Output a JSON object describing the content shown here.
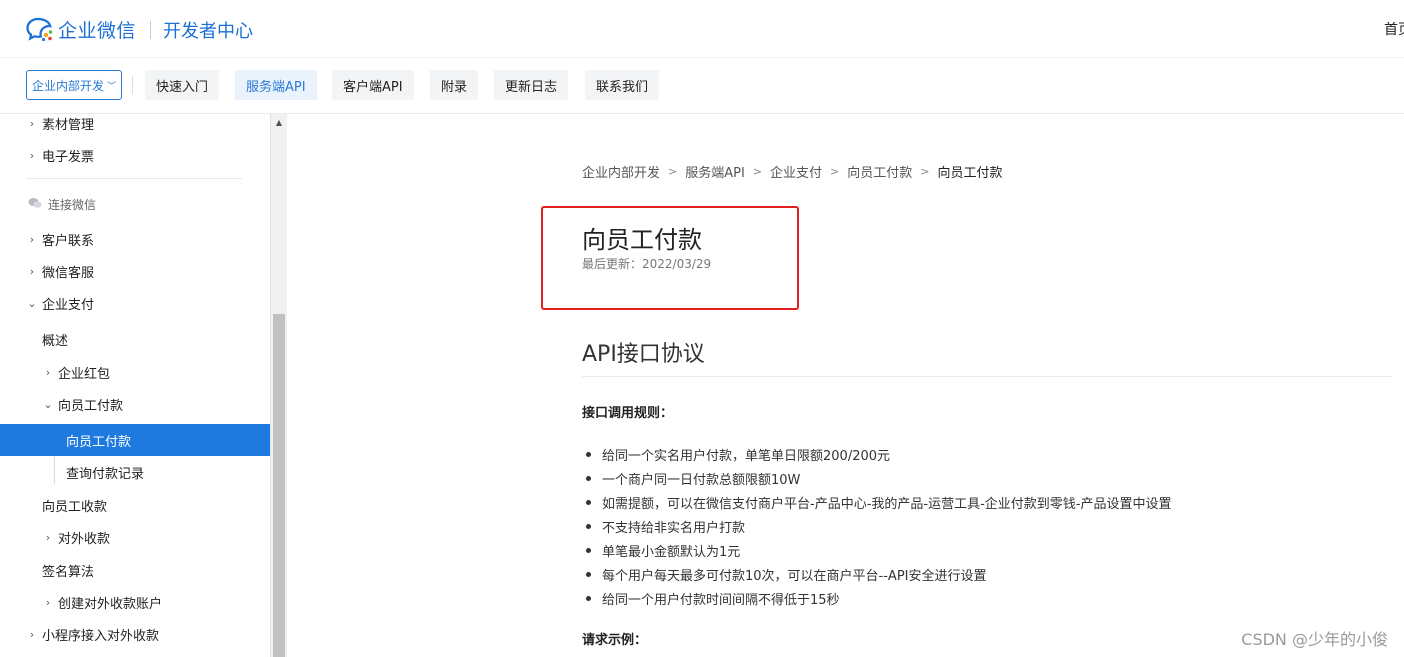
{
  "header": {
    "brand": "企业微信",
    "subtitle": "开发者中心",
    "right_link": "首页"
  },
  "tabbar": {
    "dropdown_label": "企业内部开发",
    "tabs": [
      {
        "label": "快速入门",
        "active": false
      },
      {
        "label": "服务端API",
        "active": true
      },
      {
        "label": "客户端API",
        "active": false
      },
      {
        "label": "附录",
        "active": false
      },
      {
        "label": "更新日志",
        "active": false
      },
      {
        "label": "联系我们",
        "active": false
      }
    ]
  },
  "sidebar": {
    "items": [
      {
        "label": "素材管理"
      },
      {
        "label": "电子发票"
      },
      {
        "label": "连接微信"
      },
      {
        "label": "客户联系"
      },
      {
        "label": "微信客服"
      },
      {
        "label": "企业支付"
      },
      {
        "label": "概述"
      },
      {
        "label": "企业红包"
      },
      {
        "label": "向员工付款"
      },
      {
        "label": "向员工付款"
      },
      {
        "label": "查询付款记录"
      },
      {
        "label": "向员工收款"
      },
      {
        "label": "对外收款"
      },
      {
        "label": "签名算法"
      },
      {
        "label": "创建对外收款账户"
      },
      {
        "label": "小程序接入对外收款"
      }
    ]
  },
  "content": {
    "breadcrumb": [
      "企业内部开发",
      "服务端API",
      "企业支付",
      "向员工付款",
      "向员工付款"
    ],
    "title": "向员工付款",
    "updated": "最后更新：2022/03/29",
    "section_title": "API接口协议",
    "rules_label": "接口调用规则：",
    "rules": [
      "给同一个实名用户付款，单笔单日限额200/200元",
      "一个商户同一日付款总额限额10W",
      "如需提额，可以在微信支付商户平台-产品中心-我的产品-运营工具-企业付款到零钱-产品设置中设置",
      "不支持给非实名用户打款",
      "单笔最小金额默认为1元",
      "每个用户每天最多可付款10次，可以在商户平台--API安全进行设置",
      "给同一个用户付款时间间隔不得低于15秒"
    ],
    "request_label": "请求示例："
  },
  "watermark": "CSDN @少年的小俊",
  "colors": {
    "brand": "#1c6fd6",
    "accent": "#1f7ae0",
    "highlight_box": "#e0201f"
  }
}
